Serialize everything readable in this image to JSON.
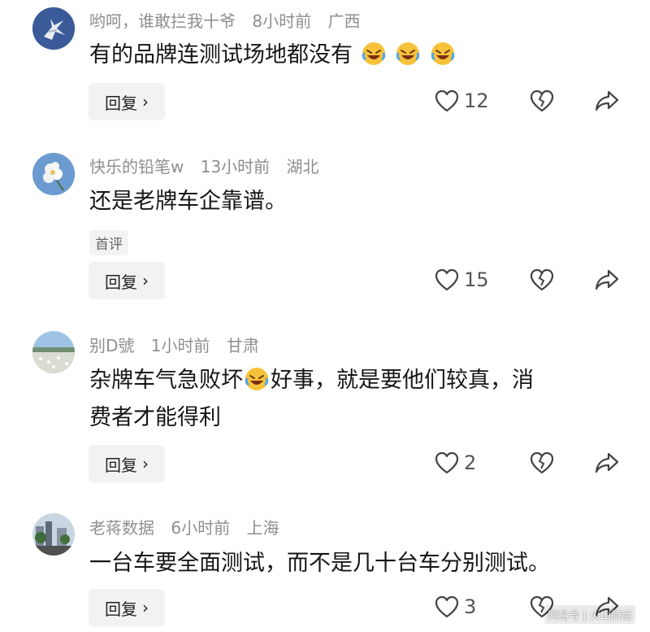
{
  "comments": [
    {
      "username": "哟呵，谁敢拦我十爷",
      "time": "8小时前",
      "location": "广西",
      "text": "有的品牌连测试场地都没有",
      "emoji_count": 3,
      "reply_label": "回复",
      "likes": "12",
      "avatar": "fighter-jet-avatar"
    },
    {
      "username": "快乐的铅笔w",
      "time": "13小时前",
      "location": "湖北",
      "text": "还是老牌车企靠谱。",
      "badge": "首评",
      "reply_label": "回复",
      "likes": "15",
      "avatar": "white-flower-avatar"
    },
    {
      "username": "别D號",
      "time": "1小时前",
      "location": "甘肃",
      "text_line1_part1": "杂牌车气急败坏",
      "text_line1_part2": "好事，就是要他们较真，消",
      "text_line2": "费者才能得利",
      "reply_label": "回复",
      "likes": "2",
      "avatar": "landscape-avatar"
    },
    {
      "username": "老蒋数据",
      "time": "6小时前",
      "location": "上海",
      "text": "一台车要全面测试，而不是几十台车分别测试。",
      "reply_label": "回复",
      "likes": "3",
      "avatar": "city-street-avatar"
    }
  ],
  "watermark": "网易号 | 火山詩話",
  "colors": {
    "meta": "#8e8e93",
    "text": "#161616",
    "reply_bg": "#f2f2f4",
    "icon": "#444444"
  }
}
